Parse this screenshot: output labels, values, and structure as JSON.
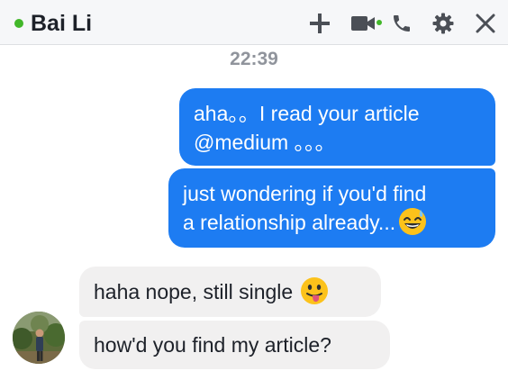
{
  "header": {
    "contact_name": "Bai Li",
    "status_color": "#42b72a",
    "icons": [
      "add-icon",
      "video-call-icon",
      "phone-icon",
      "gear-icon",
      "close-icon"
    ]
  },
  "conversation": {
    "timestamp": "22:39",
    "messages": [
      {
        "direction": "outgoing",
        "lines": [
          "aha。。I read your article",
          "@medium 。。。"
        ]
      },
      {
        "direction": "outgoing",
        "lines": [
          "just wondering if you'd find",
          "a relationship already..."
        ],
        "emoji": "grinning-sweat-emoji"
      },
      {
        "direction": "incoming",
        "lines": [
          "haha nope, still single"
        ],
        "emoji": "tongue-out-emoji"
      },
      {
        "direction": "incoming",
        "lines": [
          "how'd you find my article?"
        ]
      }
    ]
  },
  "colors": {
    "outgoing_bubble": "#1d7cf2",
    "incoming_bubble": "#f1f0f0",
    "timestamp": "#90949c"
  }
}
